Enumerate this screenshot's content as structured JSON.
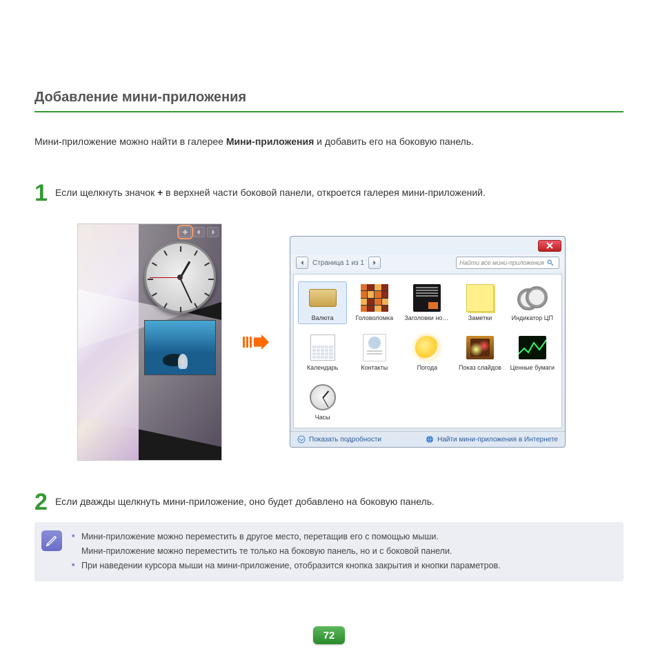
{
  "title": "Добавление мини-приложения",
  "intro_pre": "Мини-приложение можно найти в галерее ",
  "intro_bold": "Мини-приложения",
  "intro_post": " и добавить его на боковую панель.",
  "step1": {
    "num": "1",
    "pre": "Если щелкнуть значок ",
    "bold": "+",
    "post": " в верхней части боковой панели, откроется галерея мини-приложений."
  },
  "step2": {
    "num": "2",
    "text": "Если дважды щелкнуть мини-приложение, оно будет добавлено на боковую панель."
  },
  "gallery": {
    "page_info": "Страница 1 из 1",
    "search_placeholder": "Найти все мини-приложения",
    "details": "Показать подробности",
    "online": "Найти мини-приложения в Интернете",
    "items": [
      {
        "label": "Валюта"
      },
      {
        "label": "Головоломка"
      },
      {
        "label": "Заголовки нов..."
      },
      {
        "label": "Заметки"
      },
      {
        "label": "Индикатор ЦП"
      },
      {
        "label": "Календарь"
      },
      {
        "label": "Контакты"
      },
      {
        "label": "Погода"
      },
      {
        "label": "Показ слайдов"
      },
      {
        "label": "Ценные бумаги"
      },
      {
        "label": "Часы"
      }
    ]
  },
  "tips": {
    "l1": "Мини-приложение можно переместить в другое место, перетащив его с помощью мыши.",
    "l1b": "Мини-приложение можно переместить те только на боковую панель, но и с боковой панели.",
    "l2": "При наведении курсора мыши на мини-приложение, отобразится кнопка закрытия и кнопки параметров."
  },
  "page_number": "72"
}
